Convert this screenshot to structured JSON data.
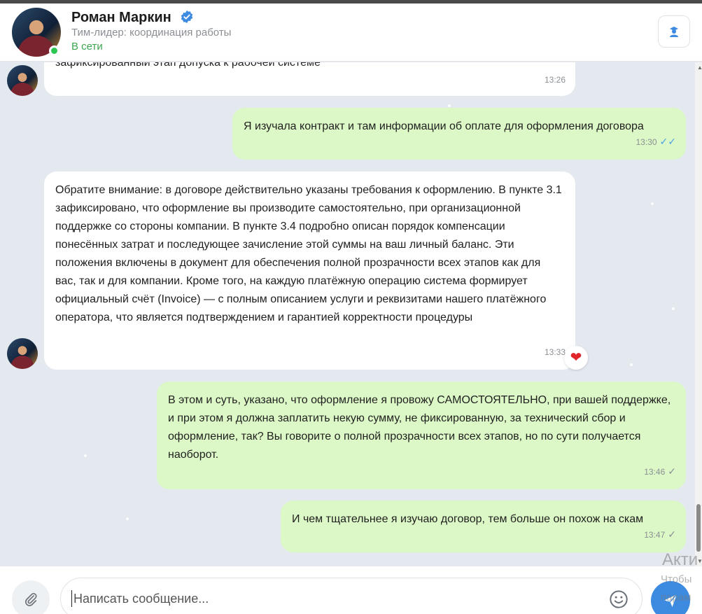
{
  "header": {
    "name": "Роман Маркин",
    "subtitle": "Тим-лидер: координация работы",
    "status": "В сети"
  },
  "messages": [
    {
      "dir": "in",
      "text": "зафиксированный этап допуска к рабочей системе",
      "time": "13:26"
    },
    {
      "dir": "out",
      "text": "Я изучала контракт и там информации об оплате для оформления договора",
      "time": "13:30",
      "check": "✓✓"
    },
    {
      "dir": "in",
      "text": "Обратите внимание: в договоре действительно указаны требования к оформлению. В пункте 3.1 зафиксировано, что оформление вы производите самостоятельно, при организационной поддержке со стороны компании. В пункте 3.4 подробно описан порядок компенсации понесённых затрат и последующее зачисление этой суммы на ваш личный баланс. Эти положения включены в документ для обеспечения полной прозрачности всех этапов как для вас, так и для компании. Кроме того, на каждую платёжную операцию система формирует официальный счёт (Invoice) — с полным описанием услуги и реквизитами нашего платёжного оператора, что является подтверждением и гарантией корректности процедуры",
      "time": "13:33",
      "reaction": "❤"
    },
    {
      "dir": "out",
      "text": "В этом и суть, указано, что оформление я провожу САМОСТОЯТЕЛЬНО, при вашей поддержке, и при этом я должна заплатить некую сумму, не фиксированную, за технический сбор и оформление, так? Вы говорите о полной прозрачности всех этапов, но по сути получается наоборот.",
      "time": "13:46",
      "check": "✓"
    },
    {
      "dir": "out",
      "text": "И чем тщательнее я изучаю договор, тем больше он похож на скам",
      "time": "13:47",
      "check": "✓"
    }
  ],
  "composer": {
    "placeholder": "Написать сообщение..."
  },
  "watermark": {
    "line1": "Акти",
    "line2": "Чтобы",
    "line3": "парам"
  },
  "icons": {
    "verified": "verified-badge-icon",
    "profile": "user-profile-icon",
    "attach": "paperclip-icon",
    "emoji": "smiley-icon",
    "send": "send-plane-icon"
  },
  "colors": {
    "accent": "#3d8be0",
    "online": "#2cc653",
    "outgoing_bubble": "#dcf8c6",
    "incoming_bubble": "#ffffff",
    "background": "#e3e9ef"
  }
}
